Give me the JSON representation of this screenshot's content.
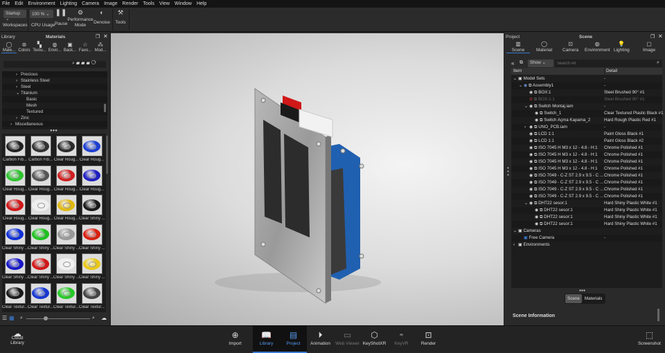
{
  "menu": [
    "File",
    "Edit",
    "Environment",
    "Lighting",
    "Camera",
    "Image",
    "Render",
    "Tools",
    "View",
    "Window",
    "Help"
  ],
  "toolbar": {
    "workspace_value": "Startup",
    "workspaces": "Workspaces",
    "cpu_value": "100 %",
    "cpu_usage": "CPU Usage",
    "pause": "Pause",
    "performance_mode": "Performance Mode",
    "denoise": "Denoise",
    "tools": "Tools"
  },
  "library": {
    "title": "Library",
    "panel_title": "Materials",
    "tabs": [
      "Mate...",
      "Colors",
      "Textu...",
      "Envir...",
      "Back...",
      "Favo...",
      "Mod..."
    ],
    "tree": [
      {
        "label": "Precious",
        "level": 1,
        "arrow": "›"
      },
      {
        "label": "Stainless Steel",
        "level": 1,
        "arrow": "›"
      },
      {
        "label": "Steel",
        "level": 1,
        "arrow": "›"
      },
      {
        "label": "Titanium",
        "level": 1,
        "arrow": "⌄"
      },
      {
        "label": "Basic",
        "level": 2,
        "arrow": ""
      },
      {
        "label": "Mesh",
        "level": 2,
        "arrow": ""
      },
      {
        "label": "Textured",
        "level": 2,
        "arrow": ""
      },
      {
        "label": "Zinc",
        "level": 1,
        "arrow": "›"
      },
      {
        "label": "Miscellaneous",
        "level": 0,
        "arrow": "›"
      }
    ],
    "materials": [
      {
        "label": "Carbon Fib...",
        "color": "#222"
      },
      {
        "label": "Carbon Fib...",
        "color": "#333"
      },
      {
        "label": "Clear Roug...",
        "color": "#2a2a2a"
      },
      {
        "label": "Clear Roug...",
        "color": "#1d3fd0"
      },
      {
        "label": "Clear Roug...",
        "color": "#2ec42e"
      },
      {
        "label": "Clear Roug...",
        "color": "#555"
      },
      {
        "label": "Clear Roug...",
        "color": "#d02020"
      },
      {
        "label": "Clear Roug...",
        "color": "#2020c0"
      },
      {
        "label": "Clear Roug...",
        "color": "#d01818"
      },
      {
        "label": "Clear Roug...",
        "color": "#eee"
      },
      {
        "label": "Clear Roug...",
        "color": "#e0b810"
      },
      {
        "label": "Clear Shiny ...",
        "color": "#1a1a1a"
      },
      {
        "label": "Clear Shiny ...",
        "color": "#1030d8"
      },
      {
        "label": "Clear Shiny ...",
        "color": "#20c020"
      },
      {
        "label": "Clear Shiny ...",
        "color": "#999"
      },
      {
        "label": "Clear Shiny ...",
        "color": "#d82010"
      },
      {
        "label": "Clear Shiny ...",
        "color": "#1818c8"
      },
      {
        "label": "Clear Shiny ...",
        "color": "#d01818"
      },
      {
        "label": "Clear Shiny ...",
        "color": "#f0f0f0"
      },
      {
        "label": "Clear Shiny ...",
        "color": "#e8c818"
      },
      {
        "label": "Clear Textur...",
        "color": "#1a1a1a"
      },
      {
        "label": "Clear Textur...",
        "color": "#1838d0"
      },
      {
        "label": "Clear Textur...",
        "color": "#28c828"
      },
      {
        "label": "Clear Textur...",
        "color": "#444"
      }
    ]
  },
  "scene": {
    "project": "Project",
    "title": "Scene",
    "tabs": [
      "Scene",
      "Material",
      "Camera",
      "Environment",
      "Lighting",
      "Image"
    ],
    "filter": "Show",
    "search_placeholder": "Search All",
    "columns": [
      "Item",
      "Detail"
    ],
    "rows": [
      {
        "label": "Model Sets",
        "detail": "-",
        "level": 0,
        "arrow": "⌄",
        "eye": false
      },
      {
        "label": "Assembly1",
        "detail": "-",
        "level": 1,
        "arrow": "⌄",
        "eye": true
      },
      {
        "label": "BOX:1",
        "detail": "Steel Brushed 90° #1",
        "level": 2,
        "arrow": "",
        "eye": true
      },
      {
        "label": "BOX-1:1",
        "detail": "Steel Brushed 90° #1",
        "level": 2,
        "arrow": "",
        "eye": true,
        "hidden": true
      },
      {
        "label": "Switch Montaj.iam",
        "detail": "-",
        "level": 2,
        "arrow": "⌄",
        "eye": true
      },
      {
        "label": "Switch_1",
        "detail": "Clear Textured Plastic Black #1",
        "level": 3,
        "arrow": "",
        "eye": true
      },
      {
        "label": "Switch Açma Kapama_2",
        "detail": "Hard Rough Plastic Red #1",
        "level": 3,
        "arrow": "",
        "eye": true
      },
      {
        "label": "UNO_PCB.iam",
        "detail": "-",
        "level": 2,
        "arrow": "›",
        "eye": true
      },
      {
        "label": "LCD 1:1",
        "detail": "Paint Gloss Black #1",
        "level": 2,
        "arrow": "",
        "eye": true
      },
      {
        "label": "LCD 1:1",
        "detail": "Paint Gloss Black #2",
        "level": 2,
        "arrow": "",
        "eye": true
      },
      {
        "label": "ISO 7045 H M3 x 12 - 4.8 - H:1",
        "detail": "Chrome Polished #1",
        "level": 2,
        "arrow": "",
        "eye": true
      },
      {
        "label": "ISO 7045 H M3 x 12 - 4.8 - H:1",
        "detail": "Chrome Polished #1",
        "level": 2,
        "arrow": "",
        "eye": true
      },
      {
        "label": "ISO 7045 H M3 x 12 - 4.8 - H:1",
        "detail": "Chrome Polished #1",
        "level": 2,
        "arrow": "",
        "eye": true
      },
      {
        "label": "ISO 7045 H M3 x 12 - 4.8 - H:1",
        "detail": "Chrome Polished #1",
        "level": 2,
        "arrow": "",
        "eye": true
      },
      {
        "label": "ISO 7049 - C-Z ST 2.9 x 9.5 - C ...",
        "detail": "Chrome Polished #1",
        "level": 2,
        "arrow": "",
        "eye": true
      },
      {
        "label": "ISO 7049 - C-Z ST 2.9 x 9.5 - C ...",
        "detail": "Chrome Polished #1",
        "level": 2,
        "arrow": "",
        "eye": true
      },
      {
        "label": "ISO 7049 - C-Z ST 2.9 x 9.5 - C ...",
        "detail": "Chrome Polished #1",
        "level": 2,
        "arrow": "",
        "eye": true
      },
      {
        "label": "ISO 7049 - C-Z ST 2.9 x 9.5 - C ...",
        "detail": "Chrome Polished #1",
        "level": 2,
        "arrow": "",
        "eye": true
      },
      {
        "label": "DHT22 sesor:1",
        "detail": "Hard Shiny Plastic White #1",
        "level": 2,
        "arrow": "⌄",
        "eye": true
      },
      {
        "label": "DHT22 sesor:1",
        "detail": "Hard Shiny Plastic White #1",
        "level": 3,
        "arrow": "",
        "eye": true
      },
      {
        "label": "DHT22 sesor:1",
        "detail": "Hard Shiny Plastic White #1",
        "level": 3,
        "arrow": "",
        "eye": true
      },
      {
        "label": "DHT22 sesor:1",
        "detail": "Hard Shiny Plastic White #1",
        "level": 3,
        "arrow": "",
        "eye": true
      },
      {
        "label": "Cameras",
        "detail": "",
        "level": 0,
        "arrow": "⌄",
        "eye": false
      },
      {
        "label": "Free Camera",
        "detail": "-",
        "level": 1,
        "arrow": "",
        "eye": false
      },
      {
        "label": "Environments",
        "detail": "",
        "level": 0,
        "arrow": "›",
        "eye": false
      }
    ],
    "toggle": [
      "Scene",
      "Materials"
    ],
    "info_title": "Scene Information"
  },
  "bottom": {
    "cloud_library": "Cloud Library",
    "items": [
      "Import",
      "Library",
      "Project",
      "Animation",
      "Web Viewer",
      "KeyShotXR",
      "KeyVR",
      "Render"
    ],
    "screenshot": "Screenshot"
  },
  "colors": {
    "accent": "#3a7bd5",
    "panel": "#2a2a2a"
  }
}
